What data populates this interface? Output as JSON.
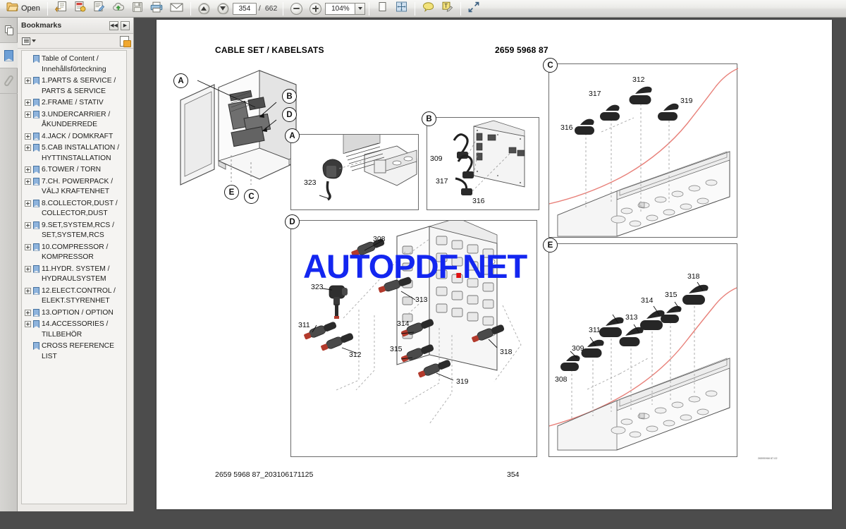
{
  "toolbar": {
    "open_label": "Open",
    "icons": [
      "open-folder-icon",
      "previous-view-icon",
      "next-view-icon",
      "edit-document-icon",
      "upload-cloud-icon",
      "save-icon",
      "print-icon",
      "email-icon",
      "page-up-icon",
      "page-down-icon",
      "zoom-out-icon",
      "zoom-in-icon",
      "fit-width-icon",
      "fit-page-icon",
      "comment-icon",
      "highlight-text-icon",
      "fullscreen-icon"
    ],
    "page_current": "354",
    "page_separator": "/",
    "page_total": "662",
    "zoom_value": "104%"
  },
  "rail": {
    "tabs": [
      {
        "name": "page-thumbnails-tab",
        "icon": "pages-icon"
      },
      {
        "name": "bookmarks-tab",
        "icon": "bookmark-icon",
        "selected": true
      },
      {
        "name": "attachments-tab",
        "icon": "paperclip-icon"
      }
    ]
  },
  "bookmarks_panel": {
    "title": "Bookmarks",
    "collapse_label": "◀◀",
    "expand_label": "▶",
    "options_icon": "list-options-icon",
    "new_bookmark_icon": "new-bookmark-icon",
    "items": [
      {
        "label": "Table of Content / Innehållsförteckning",
        "expandable": false
      },
      {
        "label": "1.PARTS & SERVICE / PARTS & SERVICE",
        "expandable": true
      },
      {
        "label": "2.FRAME / STATIV",
        "expandable": true
      },
      {
        "label": "3.UNDERCARRIER / ÅKUNDERREDE",
        "expandable": true
      },
      {
        "label": "4.JACK / DOMKRAFT",
        "expandable": true
      },
      {
        "label": "5.CAB INSTALLATION / HYTTINSTALLATION",
        "expandable": true
      },
      {
        "label": "6.TOWER / TORN",
        "expandable": true
      },
      {
        "label": "7.CH. POWERPACK / VÄLJ KRAFTENHET",
        "expandable": true
      },
      {
        "label": "8.COLLECTOR,DUST / COLLECTOR,DUST",
        "expandable": true
      },
      {
        "label": "9.SET,SYSTEM,RCS / SET,SYSTEM,RCS",
        "expandable": true
      },
      {
        "label": "10.COMPRESSOR / KOMPRESSOR",
        "expandable": true
      },
      {
        "label": "11.HYDR. SYSTEM / HYDRAULSYSTEM",
        "expandable": true
      },
      {
        "label": "12.ELECT.CONTROL / ELEKT.STYRENHET",
        "expandable": true
      },
      {
        "label": "13.OPTION / OPTION",
        "expandable": true
      },
      {
        "label": "14.ACCESSORIES / TILLBEHÖR",
        "expandable": true
      },
      {
        "label": "CROSS REFERENCE LIST",
        "expandable": false
      }
    ]
  },
  "document": {
    "title": "CABLE SET / KABELSATS",
    "part_number": "2659 5968 87",
    "footer_left": "2659 5968 87_203106171125",
    "footer_center": "354",
    "figure_code": "26595968 87-02",
    "watermark": {
      "text_before": "AUTOPDF",
      "dot": ".",
      "text_after": "NET"
    },
    "callouts_main": [
      "A",
      "B",
      "D",
      "E",
      "C"
    ],
    "panels": [
      {
        "id": "A",
        "parts": [
          "323"
        ]
      },
      {
        "id": "B",
        "parts": [
          "309",
          "317",
          "316"
        ]
      },
      {
        "id": "C",
        "parts": [
          "317",
          "312",
          "319",
          "316"
        ]
      },
      {
        "id": "D",
        "parts": [
          "308",
          "323",
          "313",
          "311",
          "314",
          "312",
          "315",
          "318",
          "319"
        ]
      },
      {
        "id": "E",
        "parts": [
          "318",
          "315",
          "314",
          "313",
          "311",
          "309",
          "308"
        ]
      }
    ]
  },
  "colors": {
    "watermark_blue": "#1326f0",
    "watermark_red": "#e01010",
    "page_background": "#ffffff",
    "viewer_background": "#4c4c4c",
    "panel_chrome": "#eceae7",
    "red_accent": "#e8817a"
  }
}
